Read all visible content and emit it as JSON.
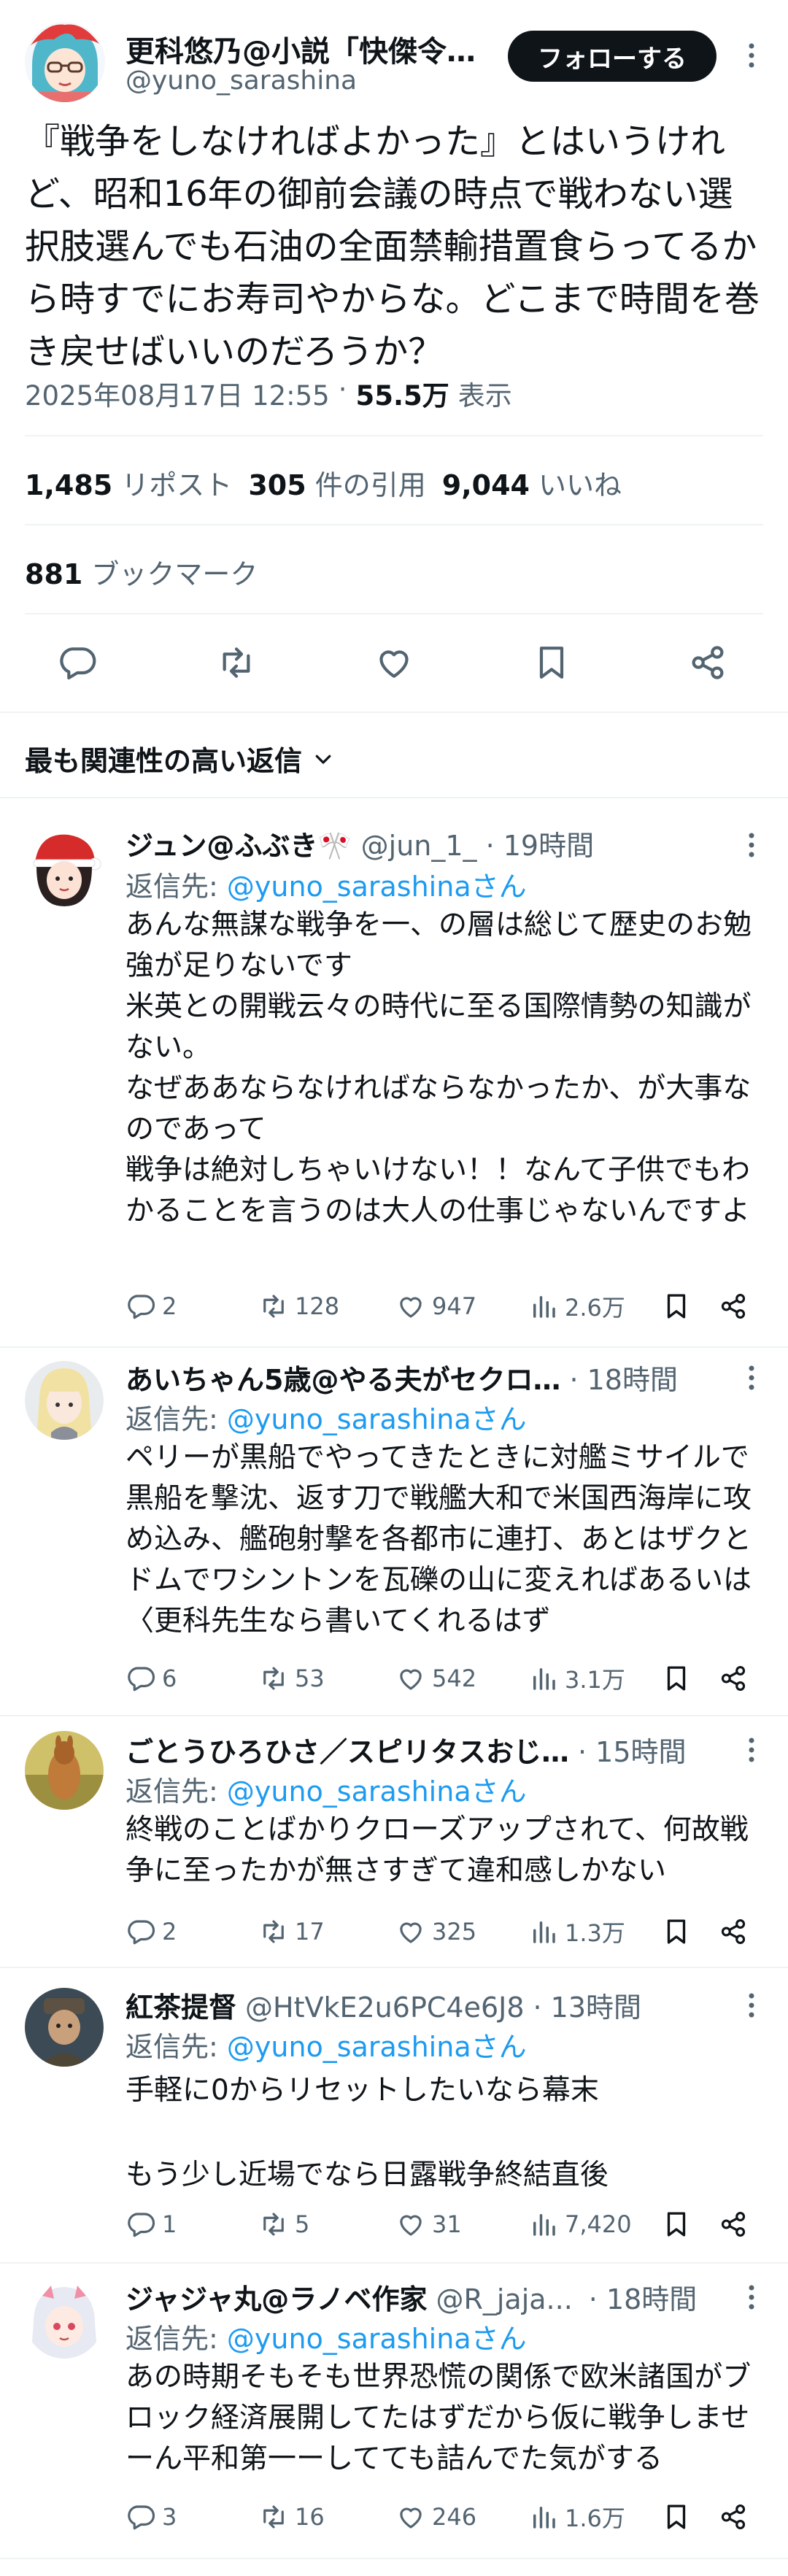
{
  "tweet": {
    "author_name": "更科悠乃@小説「快傑令…",
    "handle": "@yuno_sarashina",
    "follow_label": "フォローする",
    "text": "『戦争をしなければよかった』とはいうけれど、昭和16年の御前会議の時点で戦わない選択肢選んでも石油の全面禁輸措置食らってるから時すでにお寿司やからな。どこまで時間を巻き戻せばいいのだろうか？",
    "timestamp": "2025年08月17日 12:55",
    "separator": "·",
    "views": "55.5万",
    "views_label": "表示",
    "reposts": "1,485",
    "reposts_label": "リポスト",
    "quotes": "305",
    "quotes_label": "件の引用",
    "likes": "9,044",
    "likes_label": "いいね",
    "bookmarks": "881",
    "bookmarks_label": "ブックマーク"
  },
  "sort_label": "最も関連性の高い返信",
  "replies": [
    {
      "name": "ジュン@ふぶき🎌",
      "handle": "@jun_1_",
      "time": "· 19時間",
      "reply_to_label": "返信先:",
      "reply_to": "@yuno_sarashinaさん",
      "text": "あんな無謀な戦争を一、の層は総じて歴史のお勉強が足りないです\n米英との開戦云々の時代に至る国際情勢の知識がない。\nなぜああならなければならなかったか、が大事なのであって\n戦争は絶対しちゃいけない！！なんて子供でもわかることを言うのは大人の仕事じゃないんですよ",
      "replies_count": "2",
      "reposts": "128",
      "likes": "947",
      "views": "2.6万"
    },
    {
      "name": "あいちゃん5歳@やる夫がセクロ…",
      "handle": "",
      "time": "· 18時間",
      "reply_to_label": "返信先:",
      "reply_to": "@yuno_sarashinaさん",
      "text": "ペリーが黒船でやってきたときに対艦ミサイルで黒船を撃沈、返す刀で戦艦大和で米国西海岸に攻め込み、艦砲射撃を各都市に連打、あとはザクとドムでワシントンを瓦礫の山に変えればあるいは〈更科先生なら書いてくれるはず",
      "replies_count": "6",
      "reposts": "53",
      "likes": "542",
      "views": "3.1万"
    },
    {
      "name": "ごとうひろひさ／スピリタスおじ…",
      "handle": "",
      "time": "· 15時間",
      "reply_to_label": "返信先:",
      "reply_to": "@yuno_sarashinaさん",
      "text": "終戦のことばかりクローズアップされて、何故戦争に至ったかが無さすぎて違和感しかない",
      "replies_count": "2",
      "reposts": "17",
      "likes": "325",
      "views": "1.3万"
    },
    {
      "name": "紅茶提督",
      "handle": "@HtVkE2u6PC4e6J8",
      "time": "· 13時間",
      "reply_to_label": "返信先:",
      "reply_to": "@yuno_sarashinaさん",
      "text": "手軽に0からリセットしたいなら幕末\n\nもう少し近場でなら日露戦争終結直後",
      "replies_count": "1",
      "reposts": "5",
      "likes": "31",
      "views": "7,420"
    },
    {
      "name": "ジャジャ丸@ラノベ作家",
      "handle": "@R_jaja...",
      "time": "· 18時間",
      "reply_to_label": "返信先:",
      "reply_to": "@yuno_sarashinaさん",
      "text": "あの時期そもそも世界恐慌の関係で欧米諸国がブロック経済展開してたはずだから仮に戦争しませーん平和第一ーしてても詰んでた気がする",
      "replies_count": "3",
      "reposts": "16",
      "likes": "246",
      "views": "1.6万"
    }
  ],
  "colors": {
    "accent": "#1d9bf0",
    "text": "#0f1419",
    "muted": "#536471",
    "divider": "#eff3f4"
  },
  "icons": [
    "more-icon",
    "reply-icon",
    "repost-icon",
    "like-icon",
    "bookmark-icon",
    "share-icon",
    "views-icon",
    "chevron-down-icon"
  ]
}
